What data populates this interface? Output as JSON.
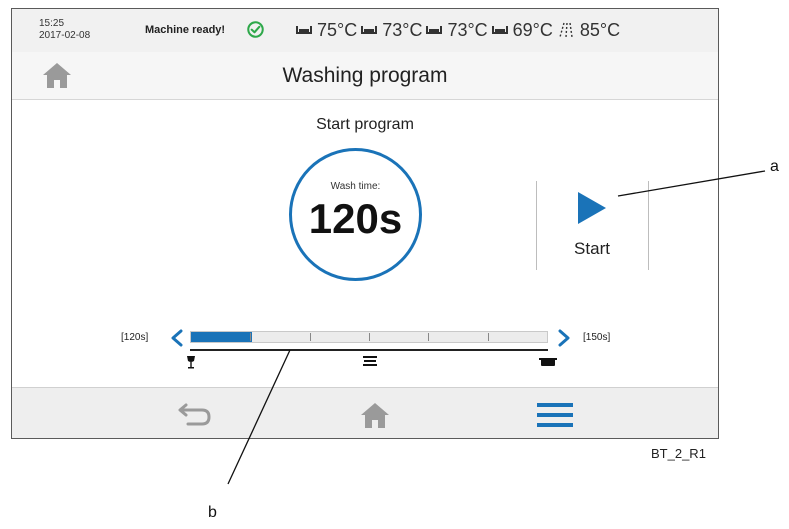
{
  "status_bar": {
    "time": "15:25",
    "date": "2017-02-08",
    "machine_status": "Machine ready!",
    "status_icon": "check-circle-icon",
    "temperatures": [
      {
        "icon": "tank-icon",
        "value": "75°C"
      },
      {
        "icon": "tank-icon",
        "value": "73°C"
      },
      {
        "icon": "tank-icon",
        "value": "73°C"
      },
      {
        "icon": "tank-icon",
        "value": "69°C"
      },
      {
        "icon": "rinse-spray-icon",
        "value": "85°C"
      }
    ]
  },
  "header": {
    "title": "Washing program",
    "home_icon": "home-icon"
  },
  "program": {
    "heading": "Start program",
    "wash_time_label": "Wash time:",
    "wash_time_value": "120s",
    "start_label": "Start",
    "start_icon": "play-icon"
  },
  "slider": {
    "min_label": "[120s]",
    "max_label": "[150s]",
    "fill_fraction": 0.17,
    "segments": 6,
    "program_icons": [
      "glass-icon",
      "plates-icon",
      "pot-icon"
    ]
  },
  "nav": {
    "items": [
      {
        "icon": "back-icon"
      },
      {
        "icon": "home-icon"
      },
      {
        "icon": "menu-icon"
      }
    ]
  },
  "annotations": {
    "callout_a": "a",
    "callout_b": "b",
    "figure_code": "BT_2_R1"
  },
  "colors": {
    "accent": "#1a73b8",
    "ok_green": "#2ea84a",
    "icon_gray": "#9a9a9a"
  }
}
